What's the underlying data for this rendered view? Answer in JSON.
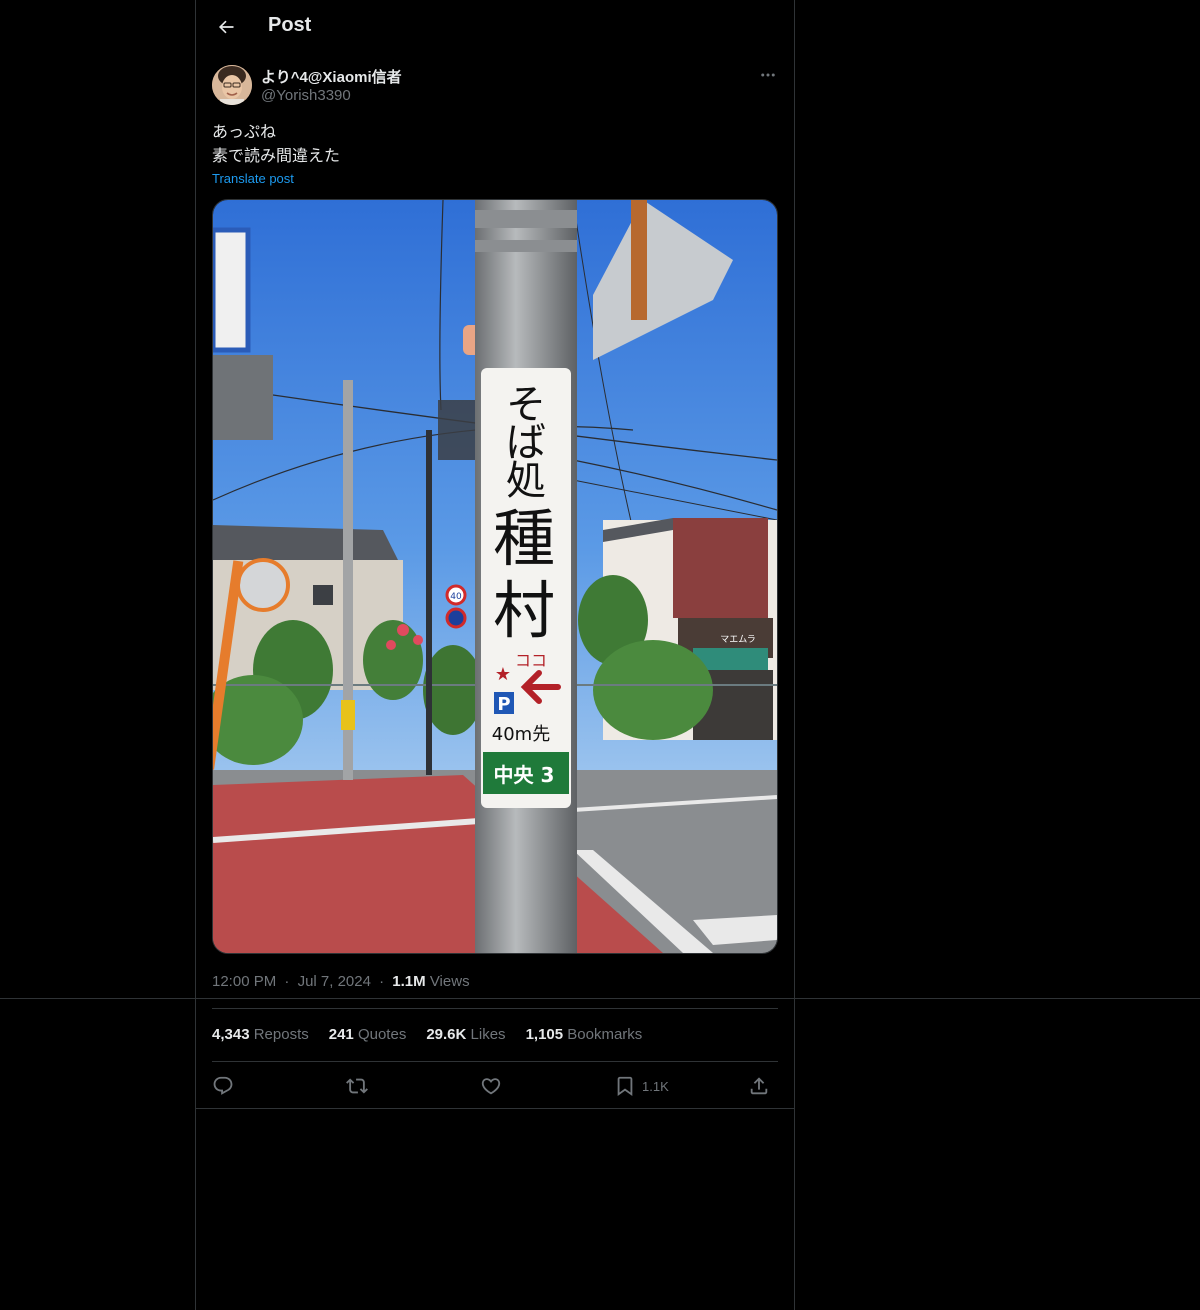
{
  "header": {
    "title": "Post"
  },
  "author": {
    "name": "より^4@Xiaomi信者",
    "handle": "@Yorish3390"
  },
  "post": {
    "lines": [
      "あっぷね",
      "素で読み間違えた"
    ],
    "translate_label": "Translate post"
  },
  "photo": {
    "sign_chars": [
      "そ",
      "ば",
      "処",
      "種",
      "村"
    ],
    "koko": "ココ",
    "star": "★",
    "parking": "P",
    "distance": "40m先",
    "area_plate": "中央 3",
    "speed_limit": "40",
    "shop_sign": "マエムラ"
  },
  "meta": {
    "time": "12:00 PM",
    "dot1": "·",
    "date": "Jul 7, 2024",
    "dot2": "·",
    "views_count": "1.1M",
    "views_label": "Views"
  },
  "stats": {
    "reposts_count": "4,343",
    "reposts_label": "Reposts",
    "quotes_count": "241",
    "quotes_label": "Quotes",
    "likes_count": "29.6K",
    "likes_label": "Likes",
    "bookmarks_count": "1,105",
    "bookmarks_label": "Bookmarks"
  },
  "actions": {
    "bookmark_count": "1.1K"
  },
  "colors": {
    "background": "#000000",
    "border": "#2f3336",
    "text_primary": "#e7e9ea",
    "text_secondary": "#71767b",
    "link": "#1d9bf0"
  }
}
